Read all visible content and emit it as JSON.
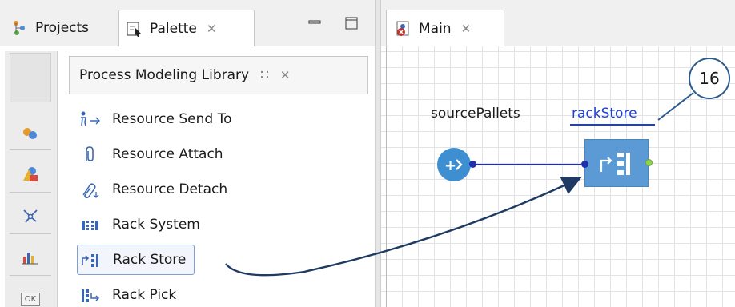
{
  "left_panel": {
    "tabs": [
      {
        "label": "Projects",
        "icon": "projects-icon"
      },
      {
        "label": "Palette",
        "icon": "palette-icon",
        "close": "✕"
      }
    ],
    "library": {
      "title": "Process Modeling Library",
      "grid_icon": "∷",
      "close": "✕"
    },
    "items": [
      {
        "label": "Resource Send To",
        "icon": "resource-send-to-icon"
      },
      {
        "label": "Resource Attach",
        "icon": "resource-attach-icon"
      },
      {
        "label": "Resource Detach",
        "icon": "resource-detach-icon"
      },
      {
        "label": "Rack System",
        "icon": "rack-system-icon"
      },
      {
        "label": "Rack Store",
        "icon": "rack-store-icon",
        "selected": true
      },
      {
        "label": "Rack Pick",
        "icon": "rack-pick-icon"
      }
    ],
    "side_buttons": [
      "agent-icon",
      "shapes-icon",
      "network-icon",
      "analysis-icon",
      "ok-button-icon"
    ],
    "ok_label": "OK"
  },
  "editor": {
    "tab": {
      "label": "Main",
      "close": "✕",
      "icon": "agent-error-icon"
    },
    "canvas": {
      "source_label": "sourcePallets",
      "store_label": "rackStore",
      "source_glyph": "+›"
    },
    "callout": "16"
  },
  "colors": {
    "accent_blue": "#3d8fd1",
    "store_block": "#5b9ad5",
    "link": "#1a3fd6",
    "callout_border": "#2c5a8c",
    "arrow": "#1f3b63",
    "port_out": "#8fd14f"
  }
}
